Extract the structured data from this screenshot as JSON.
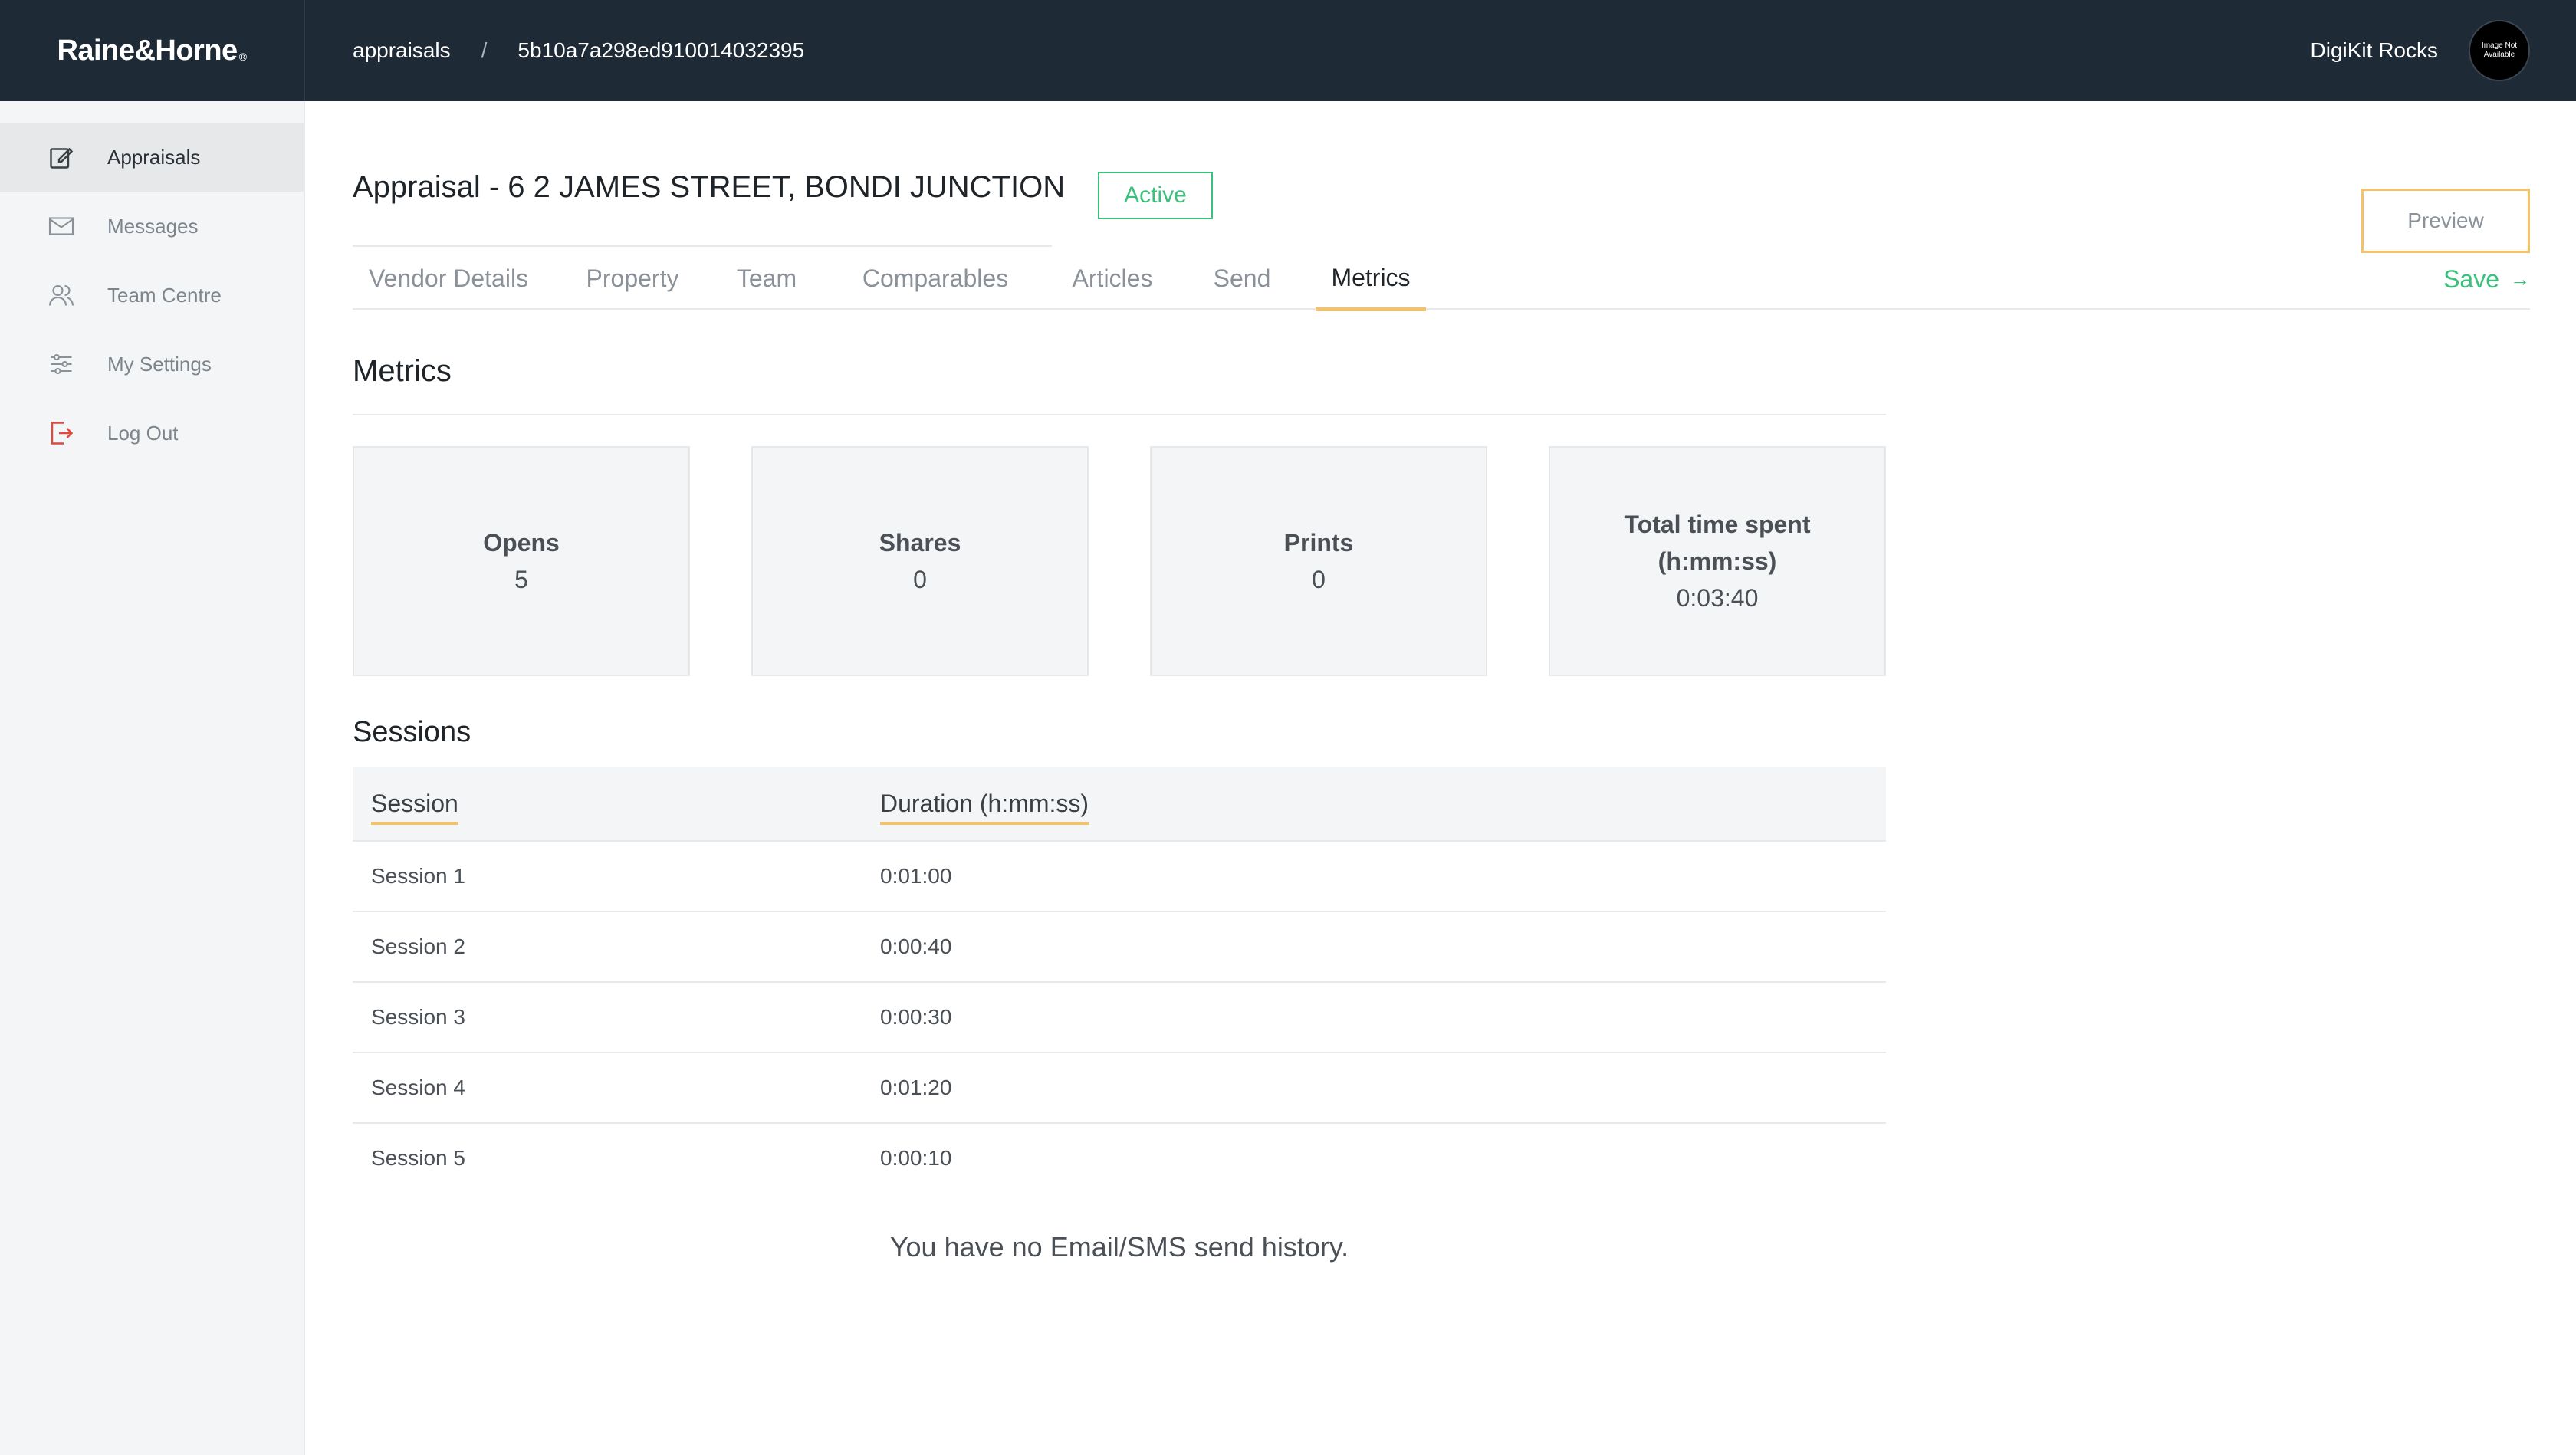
{
  "brand": {
    "name": "Raine&Horne",
    "reg": "®"
  },
  "breadcrumb": {
    "section": "appraisals",
    "separator": "/",
    "id": "5b10a7a298ed910014032395"
  },
  "user": {
    "name": "DigiKit Rocks",
    "avatar_text": "Image Not Available"
  },
  "sidebar": {
    "items": [
      {
        "label": "Appraisals",
        "icon": "edit-icon",
        "active": true
      },
      {
        "label": "Messages",
        "icon": "mail-icon",
        "active": false
      },
      {
        "label": "Team Centre",
        "icon": "team-icon",
        "active": false
      },
      {
        "label": "My Settings",
        "icon": "sliders-icon",
        "active": false
      },
      {
        "label": "Log Out",
        "icon": "logout-icon",
        "active": false
      }
    ]
  },
  "page": {
    "title": "Appraisal - 6 2 JAMES STREET, BONDI JUNCTION",
    "status": "Active",
    "preview_label": "Preview",
    "save_label": "Save"
  },
  "tabs": [
    {
      "label": "Vendor Details"
    },
    {
      "label": "Property"
    },
    {
      "label": "Team"
    },
    {
      "label": "Comparables"
    },
    {
      "label": "Articles"
    },
    {
      "label": "Send"
    },
    {
      "label": "Metrics",
      "active": true
    }
  ],
  "metrics": {
    "title": "Metrics",
    "cards": [
      {
        "label": "Opens",
        "value": "5"
      },
      {
        "label": "Shares",
        "value": "0"
      },
      {
        "label": "Prints",
        "value": "0"
      },
      {
        "label_line1": "Total time spent",
        "label_line2": "(h:mm:ss)",
        "value": "0:03:40"
      }
    ]
  },
  "sessions": {
    "title": "Sessions",
    "columns": [
      "Session",
      "Duration (h:mm:ss)"
    ],
    "rows": [
      {
        "session": "Session 1",
        "duration": "0:01:00"
      },
      {
        "session": "Session 2",
        "duration": "0:00:40"
      },
      {
        "session": "Session 3",
        "duration": "0:00:30"
      },
      {
        "session": "Session 4",
        "duration": "0:01:20"
      },
      {
        "session": "Session 5",
        "duration": "0:00:10"
      }
    ]
  },
  "empty_history": "You have no Email/SMS send history.",
  "colors": {
    "topbar": "#1e2a36",
    "accent_green": "#39c07a",
    "accent_orange": "#f3c26b"
  }
}
